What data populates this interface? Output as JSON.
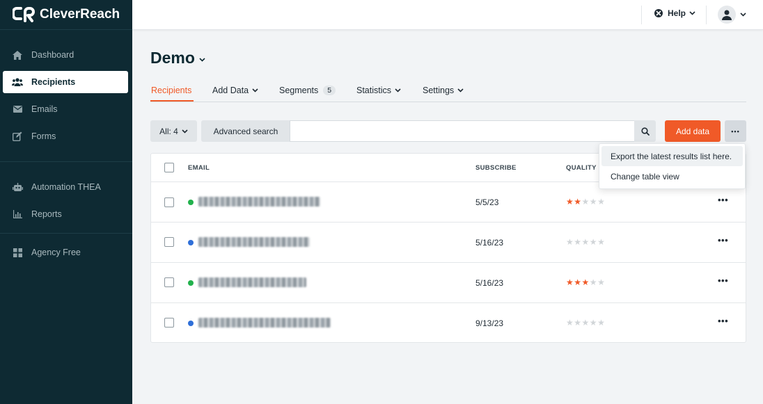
{
  "brand": {
    "name": "CleverReach",
    "accent": "#f05a28",
    "sidebar_bg": "#0e2a33"
  },
  "sidebar": {
    "items": [
      {
        "label": "Dashboard",
        "icon": "home-icon"
      },
      {
        "label": "Recipients",
        "icon": "users-icon",
        "active": true
      },
      {
        "label": "Emails",
        "icon": "envelope-icon"
      },
      {
        "label": "Forms",
        "icon": "edit-icon"
      },
      {
        "label": "Automation THEA",
        "icon": "robot-icon"
      },
      {
        "label": "Reports",
        "icon": "bar-chart-icon"
      },
      {
        "label": "Agency Free",
        "icon": "grid-icon"
      }
    ]
  },
  "topbar": {
    "help_label": "Help"
  },
  "page": {
    "title": "Demo"
  },
  "tabs": [
    {
      "label": "Recipients",
      "active": true
    },
    {
      "label": "Add Data"
    },
    {
      "label": "Segments",
      "badge": "5"
    },
    {
      "label": "Statistics"
    },
    {
      "label": "Settings"
    }
  ],
  "filter": {
    "all_label": "All: 4",
    "advanced_search_label": "Advanced search",
    "search_value": "",
    "add_data_label": "Add data",
    "more_label": "•••"
  },
  "table": {
    "columns": {
      "email": "EMAIL",
      "subscribe": "SUBSCRIBE",
      "quality": "QUALITY"
    },
    "rows": [
      {
        "status_color": "#22b14c",
        "subscribe": "5/5/23",
        "quality": 2,
        "menu": "•••"
      },
      {
        "status_color": "#2f6fd8",
        "subscribe": "5/16/23",
        "quality": 0,
        "menu": "•••"
      },
      {
        "status_color": "#22b14c",
        "subscribe": "5/16/23",
        "quality": 3,
        "menu": "•••"
      },
      {
        "status_color": "#2f6fd8",
        "subscribe": "9/13/23",
        "quality": 0,
        "menu": "•••"
      }
    ]
  },
  "dropdown": {
    "items": [
      {
        "label": "Export the latest results list here."
      },
      {
        "label": "Change table view"
      }
    ]
  }
}
